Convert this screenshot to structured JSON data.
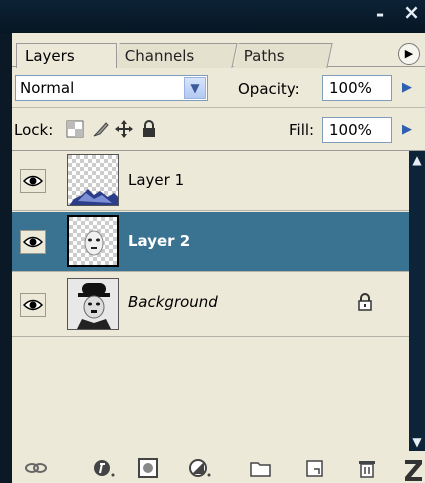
{
  "window": {
    "minimize_glyph": "-",
    "close_glyph": "×"
  },
  "tabs": [
    {
      "label": "Layers",
      "active": true
    },
    {
      "label": "Channels",
      "active": false
    },
    {
      "label": "Paths",
      "active": false
    }
  ],
  "blend": {
    "mode": "Normal",
    "opacity_label": "Opacity:",
    "opacity_value": "100%"
  },
  "lock": {
    "label": "Lock:",
    "icons": [
      "lock-transparent-pixels-icon",
      "lock-image-pixels-icon",
      "lock-position-icon",
      "lock-all-icon"
    ],
    "fill_label": "Fill:",
    "fill_value": "100%"
  },
  "layers": [
    {
      "name": "Layer 1",
      "visible": true,
      "selected": false,
      "italic": false,
      "locked": false
    },
    {
      "name": "Layer 2",
      "visible": true,
      "selected": true,
      "italic": false,
      "locked": false
    },
    {
      "name": "Background",
      "visible": true,
      "selected": false,
      "italic": true,
      "locked": true
    }
  ],
  "bottom_icons": [
    "link-layers-icon",
    "layer-style-icon",
    "layer-mask-icon",
    "adjustment-layer-icon",
    "new-group-icon",
    "new-layer-icon",
    "delete-layer-icon"
  ],
  "colors": {
    "panel_bg": "#ece9d8",
    "selected_row": "#3a7391",
    "titlebar": "#0c2236",
    "arrow_blue": "#2e5fb0"
  }
}
